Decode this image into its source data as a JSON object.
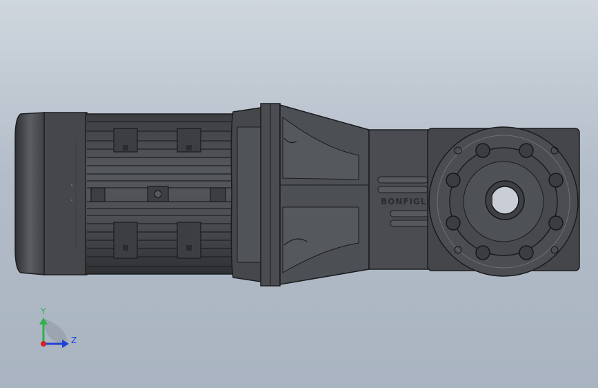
{
  "viewport": {
    "background_top": "#cfd6de",
    "background_bottom": "#a9b4c1",
    "model_color": "#47494d",
    "model_edge_color": "#1a1b1d"
  },
  "model": {
    "name": "gearmotor",
    "casting_text": "BONFIGLI"
  },
  "triad": {
    "y_label": "Y",
    "z_label": "Z",
    "y_color": "#2db24a",
    "z_color": "#2340d6",
    "x_color": "#d42222"
  }
}
